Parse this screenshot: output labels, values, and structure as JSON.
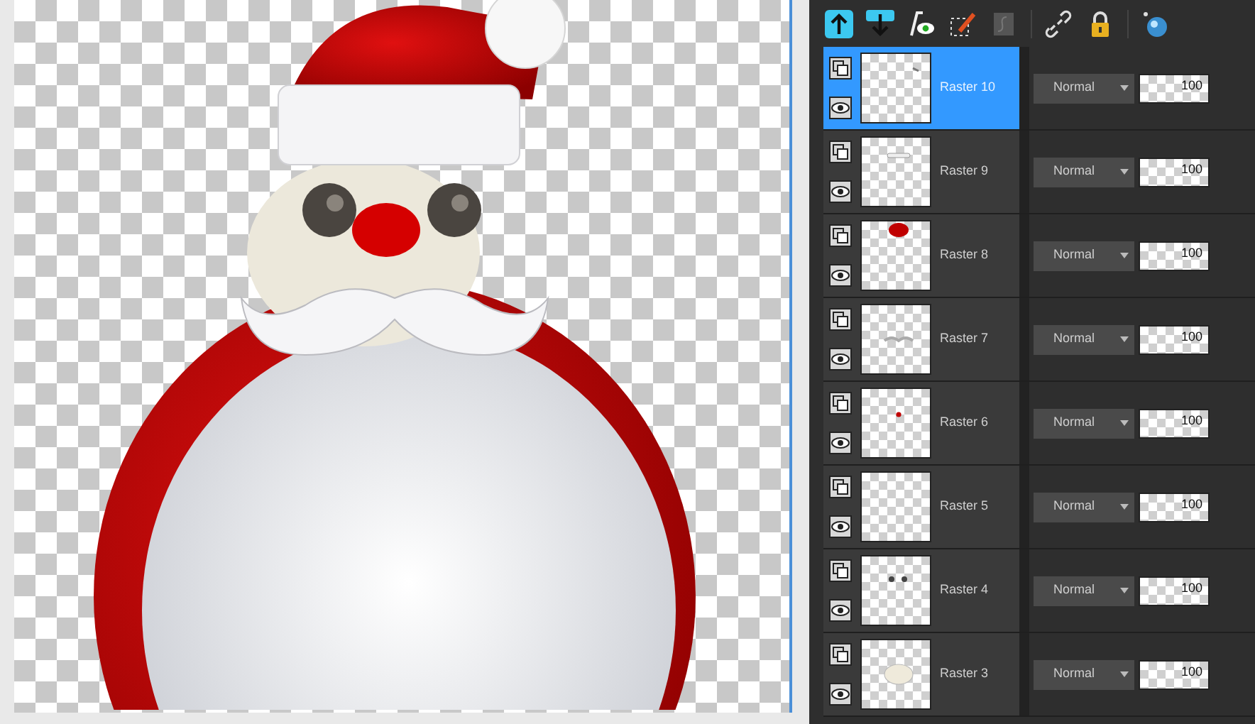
{
  "layers": [
    {
      "name": "Raster 10",
      "selected": true,
      "visible": true,
      "blend_mode": "Normal",
      "opacity": "100"
    },
    {
      "name": "Raster 9",
      "selected": false,
      "visible": true,
      "blend_mode": "Normal",
      "opacity": "100"
    },
    {
      "name": "Raster 8",
      "selected": false,
      "visible": true,
      "blend_mode": "Normal",
      "opacity": "100"
    },
    {
      "name": "Raster 7",
      "selected": false,
      "visible": true,
      "blend_mode": "Normal",
      "opacity": "100"
    },
    {
      "name": "Raster 6",
      "selected": false,
      "visible": true,
      "blend_mode": "Normal",
      "opacity": "100"
    },
    {
      "name": "Raster 5",
      "selected": false,
      "visible": true,
      "blend_mode": "Normal",
      "opacity": "100"
    },
    {
      "name": "Raster 4",
      "selected": false,
      "visible": true,
      "blend_mode": "Normal",
      "opacity": "100"
    },
    {
      "name": "Raster 3",
      "selected": false,
      "visible": true,
      "blend_mode": "Normal",
      "opacity": "100"
    }
  ]
}
